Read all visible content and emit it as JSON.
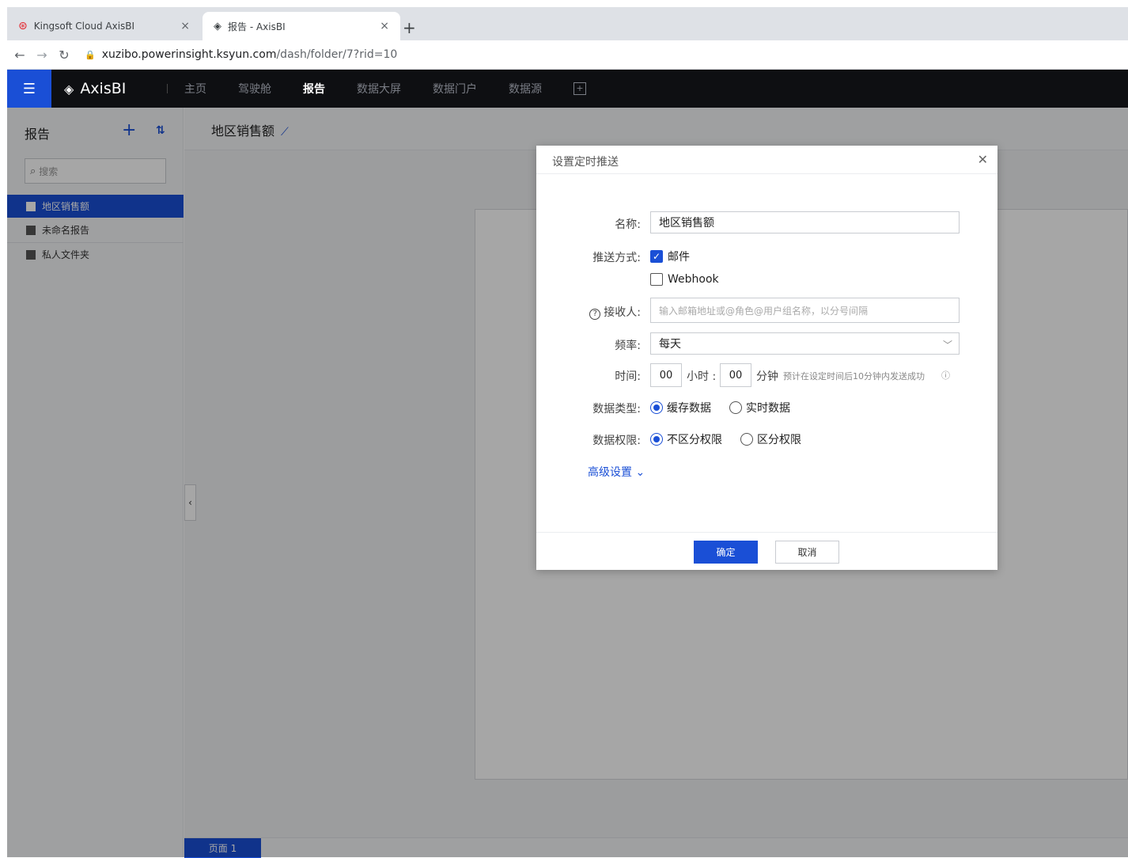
{
  "browser": {
    "tabs": [
      {
        "title": "Kingsoft Cloud AxisBI"
      },
      {
        "title": "报告 - AxisBI"
      }
    ],
    "close_glyph": "×",
    "new_tab_glyph": "+",
    "url_host": "xuzibo.powerinsight.ksyun.com",
    "url_path": "/dash/folder/7?rid=10"
  },
  "appbar": {
    "brand": "AxisBI",
    "nav": [
      {
        "label": "主页"
      },
      {
        "label": "驾驶舱"
      },
      {
        "label": "报告",
        "active": true
      },
      {
        "label": "数据大屏"
      },
      {
        "label": "数据门户"
      },
      {
        "label": "数据源"
      }
    ]
  },
  "sidebar": {
    "title": "报告",
    "search_placeholder": "搜索",
    "items": [
      {
        "label": "地区销售额",
        "active": true
      },
      {
        "label": "未命名报告"
      },
      {
        "label": "私人文件夹"
      }
    ]
  },
  "main": {
    "title": "地区销售额",
    "page_tab": "页面 1"
  },
  "dialog": {
    "title": "设置定时推送",
    "name_label": "名称:",
    "name_value": "地区销售额",
    "push_label": "推送方式:",
    "push_email": "邮件",
    "push_webhook": "Webhook",
    "recipient_label": "接收人:",
    "recipient_placeholder": "输入邮箱地址或@角色@用户组名称，以分号间隔",
    "freq_label": "频率:",
    "freq_value": "每天",
    "time_label": "时间:",
    "hour_value": "00",
    "hour_unit": "小时 :",
    "minute_value": "00",
    "minute_unit": "分钟",
    "time_hint": "预计在设定时间后10分钟内发送成功",
    "datatype_label": "数据类型:",
    "datatype_cache": "缓存数据",
    "datatype_realtime": "实时数据",
    "perm_label": "数据权限:",
    "perm_none": "不区分权限",
    "perm_split": "区分权限",
    "advanced": "高级设置",
    "ok": "确定",
    "cancel": "取消"
  },
  "colors": {
    "accent": "#1a4fd6",
    "appbar_bg": "#0e0f12"
  }
}
